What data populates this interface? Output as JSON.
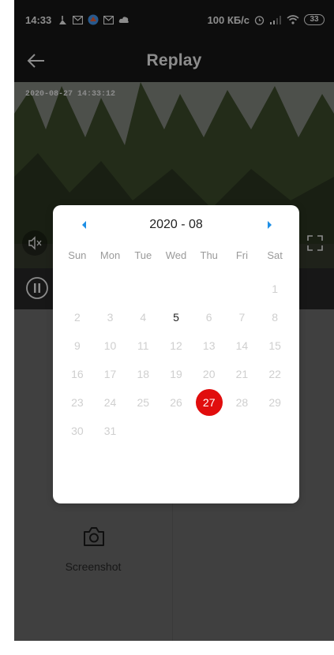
{
  "status_bar": {
    "time": "14:33",
    "speed": "100 КБ/с",
    "battery": "33"
  },
  "header": {
    "title": "Replay"
  },
  "video": {
    "timestamp": "2020-08-27 14:33:12"
  },
  "body": {
    "screenshot_label": "Screenshot"
  },
  "calendar": {
    "month_label": "2020 - 08",
    "weekdays": [
      "Sun",
      "Mon",
      "Tue",
      "Wed",
      "Thu",
      "Fri",
      "Sat"
    ],
    "first_weekday_index": 6,
    "days_in_month": 31,
    "available_days": [
      5,
      27
    ],
    "selected_day": 27,
    "accent_color": "#e10d0d",
    "nav_color": "#1e8fe6"
  }
}
